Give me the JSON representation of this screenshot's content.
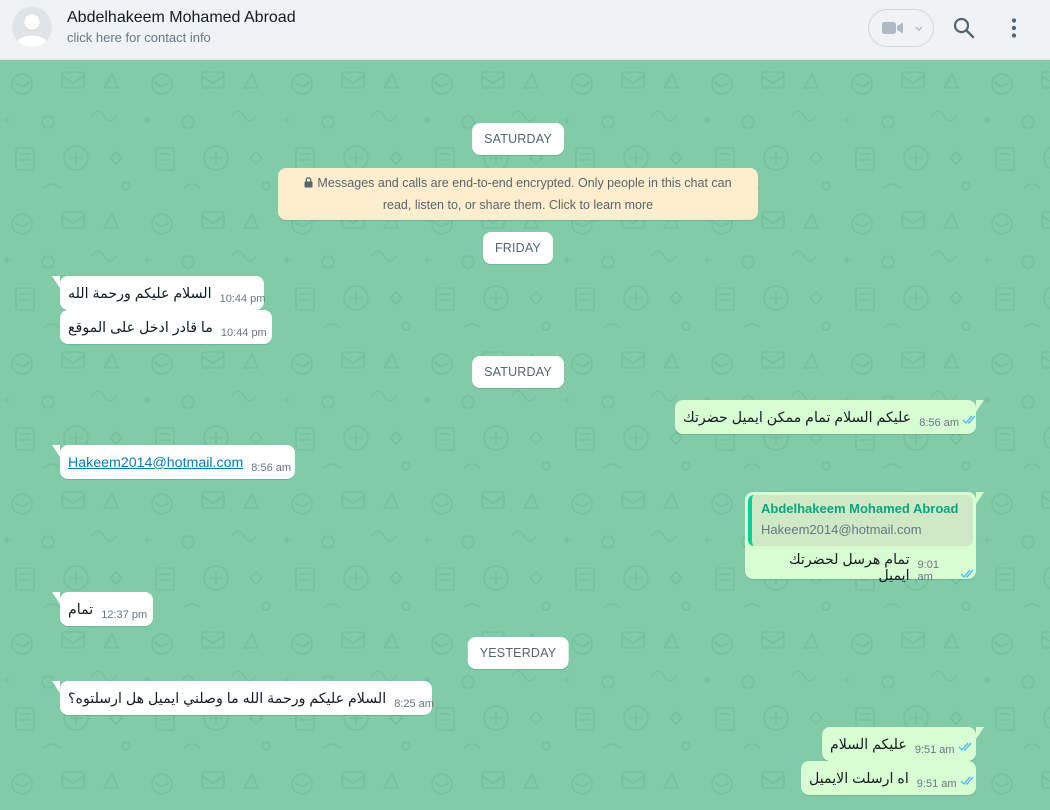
{
  "header": {
    "contact_name": "Abdelhakeem Mohamed Abroad",
    "contact_subtitle": "click here for contact info",
    "icons": [
      "avatar-default-icon",
      "video-camera-icon",
      "chevron-down-icon",
      "search-icon",
      "menu-dots-icon"
    ]
  },
  "chat": {
    "day_separators": [
      "SATURDAY",
      "FRIDAY",
      "SATURDAY",
      "YESTERDAY"
    ],
    "encryption_notice": "Messages and calls are end-to-end encrypted. Only people in this chat can read, listen to, or share them. Click to learn more",
    "messages": [
      {
        "direction": "incoming",
        "text": "السلام عليكم ورحمة الله",
        "time": "10:44 pm"
      },
      {
        "direction": "incoming",
        "text": "ما قادر ادخل على الموقع",
        "time": "10:44 pm"
      },
      {
        "direction": "outgoing",
        "text": "عليكم السلام تمام ممكن ايميل حضرتك",
        "time": "8:56 am",
        "status": "read"
      },
      {
        "direction": "incoming",
        "text": "Hakeem2014@hotmail.com",
        "time": "8:56 am",
        "link": true
      },
      {
        "direction": "outgoing",
        "quoted_author": "Abdelhakeem Mohamed Abroad",
        "quoted_text": "Hakeem2014@hotmail.com",
        "text": "تمام هرسل لحضرتك ايميل",
        "time": "9:01 am",
        "status": "read"
      },
      {
        "direction": "incoming",
        "text": "تمام",
        "time": "12:37 pm"
      },
      {
        "direction": "incoming",
        "text": "السلام عليكم ورحمة الله ما وصلني ايميل هل ارسلتوه؟",
        "time": "8:25 am"
      },
      {
        "direction": "outgoing",
        "text": "عليكم السلام",
        "time": "9:51 am",
        "status": "read"
      },
      {
        "direction": "outgoing",
        "text": "اه ارسلت الايميل",
        "time": "9:51 am",
        "status": "read"
      }
    ]
  },
  "colors": {
    "header_bg": "#f0f2f5",
    "chat_bg": "#81cba9",
    "incoming_bubble": "#ffffff",
    "outgoing_bubble": "#d9fdd3",
    "encryption_bg": "#ffeecd",
    "read_ticks": "#53bdeb",
    "quote_accent": "#06cf9c"
  }
}
